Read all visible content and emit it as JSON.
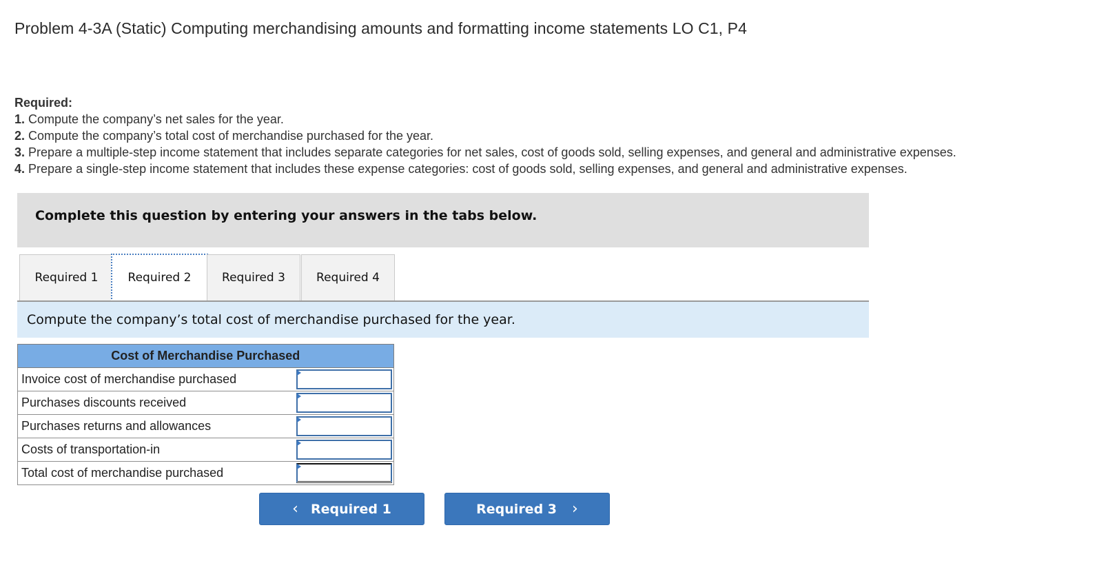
{
  "page_title": "Problem 4-3A (Static) Computing merchandising amounts and formatting income statements LO C1, P4",
  "required": {
    "heading": "Required:",
    "items": [
      {
        "num": "1.",
        "text": "Compute the company’s net sales for the year."
      },
      {
        "num": "2.",
        "text": "Compute the company’s total cost of merchandise purchased for the year."
      },
      {
        "num": "3.",
        "text": "Prepare a multiple-step income statement that includes separate categories for net sales, cost of goods sold, selling expenses, and general and administrative expenses."
      },
      {
        "num": "4.",
        "text": "Prepare a single-step income statement that includes these expense categories: cost of goods sold, selling expenses, and general and administrative expenses."
      }
    ]
  },
  "instructions": "Complete this question by entering your answers in the tabs below.",
  "tabs": [
    {
      "label": "Required 1",
      "active": false
    },
    {
      "label": "Required 2",
      "active": true
    },
    {
      "label": "Required 3",
      "active": false
    },
    {
      "label": "Required 4",
      "active": false
    }
  ],
  "tab_description": "Compute the company’s total cost of merchandise purchased for the year.",
  "table": {
    "header": "Cost of Merchandise Purchased",
    "rows": [
      {
        "label": "Invoice cost of merchandise purchased",
        "value": ""
      },
      {
        "label": "Purchases discounts received",
        "value": ""
      },
      {
        "label": "Purchases returns and allowances",
        "value": ""
      },
      {
        "label": "Costs of transportation-in",
        "value": ""
      },
      {
        "label": "Total cost of merchandise purchased",
        "value": ""
      }
    ]
  },
  "nav": {
    "prev_label": "Required 1",
    "prev_icon": "‹",
    "next_label": "Required 3",
    "next_icon": "›"
  },
  "colors": {
    "accent": "#3b77bc",
    "table_header": "#78ace4",
    "tab_description_bg": "#dbebf8",
    "instructions_bg": "#dfdfdf"
  }
}
